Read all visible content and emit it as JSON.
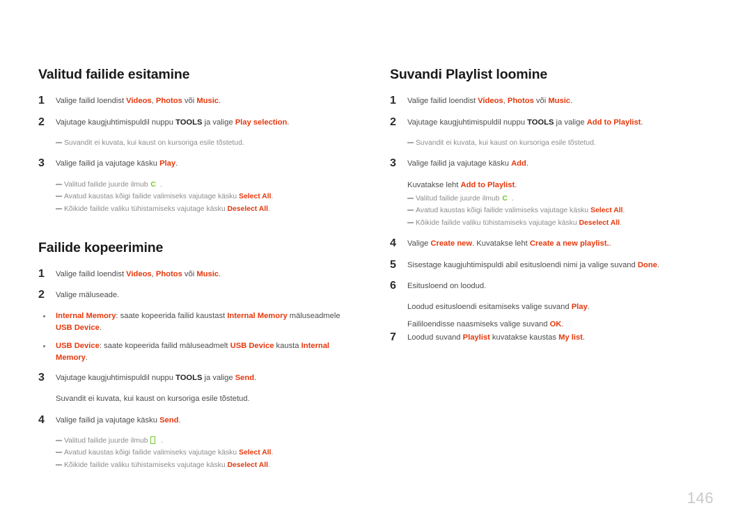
{
  "page": {
    "number": "146",
    "accent_color": "#e5380c",
    "glyph_color": "#6ec72a",
    "body_color": "#4c4c4c",
    "subnote_color": "#8d8d8d"
  },
  "left_column": {
    "sections": [
      {
        "title": "Valitud failide esitamine",
        "blocks": [
          {
            "kind": "step",
            "num": "1",
            "parts": [
              {
                "t": "Valige failid loendist ",
                "s": "plain"
              },
              {
                "t": "Videos",
                "s": "kw"
              },
              {
                "t": ", ",
                "s": "plain"
              },
              {
                "t": "Photos",
                "s": "kw"
              },
              {
                "t": " või ",
                "s": "plain"
              },
              {
                "t": "Music",
                "s": "kw"
              },
              {
                "t": ".",
                "s": "plain"
              }
            ]
          },
          {
            "kind": "step",
            "num": "2",
            "parts": [
              {
                "t": "Vajutage kaugjuhtimispuldil nuppu ",
                "s": "plain"
              },
              {
                "t": "TOOLS",
                "s": "kw-dark"
              },
              {
                "t": " ja valige ",
                "s": "plain"
              },
              {
                "t": "Play selection",
                "s": "kw"
              },
              {
                "t": ".",
                "s": "plain"
              }
            ]
          },
          {
            "kind": "subnotes",
            "items": [
              {
                "parts": [
                  {
                    "t": "Suvandit ei kuvata, kui kaust on kursoriga esile tõstetud.",
                    "s": "plain"
                  }
                ]
              }
            ]
          },
          {
            "kind": "step",
            "num": "3",
            "parts": [
              {
                "t": "Valige failid ja vajutage käsku ",
                "s": "plain"
              },
              {
                "t": "Play",
                "s": "kw"
              },
              {
                "t": ".",
                "s": "plain"
              }
            ]
          },
          {
            "kind": "subnotes",
            "items": [
              {
                "parts": [
                  {
                    "t": "Valitud failide juurde ilmub ",
                    "s": "plain"
                  },
                  {
                    "t": "C",
                    "s": "glyph-check"
                  },
                  {
                    "t": ".",
                    "s": "plain"
                  }
                ]
              },
              {
                "parts": [
                  {
                    "t": "Avatud kaustas kõigi failide valimiseks vajutage käsku ",
                    "s": "plain"
                  },
                  {
                    "t": "Select All",
                    "s": "kw"
                  },
                  {
                    "t": ".",
                    "s": "plain"
                  }
                ]
              },
              {
                "parts": [
                  {
                    "t": "Kõikide failide valiku tühistamiseks vajutage käsku ",
                    "s": "plain"
                  },
                  {
                    "t": "Deselect All",
                    "s": "kw"
                  },
                  {
                    "t": ".",
                    "s": "plain"
                  }
                ]
              }
            ]
          }
        ]
      },
      {
        "title": "Failide kopeerimine",
        "blocks": [
          {
            "kind": "step",
            "num": "1",
            "parts": [
              {
                "t": "Valige failid loendist ",
                "s": "plain"
              },
              {
                "t": "Videos",
                "s": "kw"
              },
              {
                "t": ", ",
                "s": "plain"
              },
              {
                "t": "Photos",
                "s": "kw"
              },
              {
                "t": " või ",
                "s": "plain"
              },
              {
                "t": "Music",
                "s": "kw"
              },
              {
                "t": ".",
                "s": "plain"
              }
            ]
          },
          {
            "kind": "step",
            "num": "2",
            "parts": [
              {
                "t": "Valige mäluseade.",
                "s": "plain"
              }
            ]
          },
          {
            "kind": "bullets",
            "items": [
              {
                "parts": [
                  {
                    "t": "Internal Memory",
                    "s": "kw"
                  },
                  {
                    "t": ": saate kopeerida failid kaustast ",
                    "s": "plain"
                  },
                  {
                    "t": "Internal Memory",
                    "s": "kw"
                  },
                  {
                    "t": " mäluseadmele ",
                    "s": "plain"
                  },
                  {
                    "t": "USB Device",
                    "s": "kw"
                  },
                  {
                    "t": ".",
                    "s": "plain"
                  }
                ]
              },
              {
                "parts": [
                  {
                    "t": "USB Device",
                    "s": "kw"
                  },
                  {
                    "t": ": saate kopeerida failid mäluseadmelt ",
                    "s": "plain"
                  },
                  {
                    "t": "USB Device",
                    "s": "kw"
                  },
                  {
                    "t": " kausta ",
                    "s": "plain"
                  },
                  {
                    "t": "Internal Memory",
                    "s": "kw"
                  },
                  {
                    "t": ".",
                    "s": "plain"
                  }
                ]
              }
            ]
          },
          {
            "kind": "step",
            "num": "3",
            "parts": [
              {
                "t": "Vajutage kaugjuhtimispuldil nuppu ",
                "s": "plain"
              },
              {
                "t": "TOOLS",
                "s": "kw-dark"
              },
              {
                "t": " ja valige ",
                "s": "plain"
              },
              {
                "t": "Send",
                "s": "kw"
              },
              {
                "t": ".",
                "s": "plain"
              }
            ]
          },
          {
            "kind": "body",
            "parts": [
              {
                "t": "Suvandit ei kuvata, kui kaust on kursoriga esile tõstetud.",
                "s": "plain"
              }
            ]
          },
          {
            "kind": "step",
            "num": "4",
            "parts": [
              {
                "t": "Valige failid ja vajutage käsku ",
                "s": "plain"
              },
              {
                "t": "Send",
                "s": "kw"
              },
              {
                "t": ".",
                "s": "plain"
              }
            ]
          },
          {
            "kind": "subnotes",
            "items": [
              {
                "parts": [
                  {
                    "t": "Valitud failide juurde ilmub ",
                    "s": "plain"
                  },
                  {
                    "t": " ",
                    "s": "glyph-box"
                  },
                  {
                    "t": ".",
                    "s": "plain"
                  }
                ]
              },
              {
                "parts": [
                  {
                    "t": "Avatud kaustas kõigi failide valimiseks vajutage käsku ",
                    "s": "plain"
                  },
                  {
                    "t": "Select All",
                    "s": "kw"
                  },
                  {
                    "t": ".",
                    "s": "plain"
                  }
                ]
              },
              {
                "parts": [
                  {
                    "t": "Kõikide failide valiku tühistamiseks vajutage käsku ",
                    "s": "plain"
                  },
                  {
                    "t": "Deselect All",
                    "s": "kw"
                  },
                  {
                    "t": ".",
                    "s": "plain"
                  }
                ]
              }
            ]
          }
        ]
      }
    ]
  },
  "right_column": {
    "sections": [
      {
        "title": "Suvandi Playlist loomine",
        "blocks": [
          {
            "kind": "step",
            "num": "1",
            "parts": [
              {
                "t": "Valige failid loendist ",
                "s": "plain"
              },
              {
                "t": "Videos",
                "s": "kw"
              },
              {
                "t": ", ",
                "s": "plain"
              },
              {
                "t": "Photos",
                "s": "kw"
              },
              {
                "t": " või ",
                "s": "plain"
              },
              {
                "t": "Music",
                "s": "kw"
              },
              {
                "t": ".",
                "s": "plain"
              }
            ]
          },
          {
            "kind": "step",
            "num": "2",
            "parts": [
              {
                "t": "Vajutage kaugjuhtimispuldil nuppu ",
                "s": "plain"
              },
              {
                "t": "TOOLS",
                "s": "kw-dark"
              },
              {
                "t": " ja valige ",
                "s": "plain"
              },
              {
                "t": "Add to Playlist",
                "s": "kw"
              },
              {
                "t": ".",
                "s": "plain"
              }
            ]
          },
          {
            "kind": "subnotes",
            "items": [
              {
                "parts": [
                  {
                    "t": "Suvandit ei kuvata, kui kaust on kursoriga esile tõstetud.",
                    "s": "plain"
                  }
                ]
              }
            ]
          },
          {
            "kind": "step",
            "num": "3",
            "parts": [
              {
                "t": "Valige failid ja vajutage käsku ",
                "s": "plain"
              },
              {
                "t": "Add",
                "s": "kw"
              },
              {
                "t": ".",
                "s": "plain"
              }
            ]
          },
          {
            "kind": "body-compact",
            "parts": [
              {
                "t": "Kuvatakse leht ",
                "s": "plain"
              },
              {
                "t": "Add to Playlist",
                "s": "kw"
              },
              {
                "t": ".",
                "s": "plain"
              }
            ]
          },
          {
            "kind": "subnotes-nogap",
            "items": [
              {
                "parts": [
                  {
                    "t": "Valitud failide juurde ilmub ",
                    "s": "plain"
                  },
                  {
                    "t": "C",
                    "s": "glyph-check"
                  },
                  {
                    "t": ".",
                    "s": "plain"
                  }
                ]
              },
              {
                "parts": [
                  {
                    "t": "Avatud kaustas kõigi failide valimiseks vajutage käsku ",
                    "s": "plain"
                  },
                  {
                    "t": "Select All",
                    "s": "kw"
                  },
                  {
                    "t": ".",
                    "s": "plain"
                  }
                ]
              },
              {
                "parts": [
                  {
                    "t": "Kõikide failide valiku tühistamiseks vajutage käsku ",
                    "s": "plain"
                  },
                  {
                    "t": "Deselect All",
                    "s": "kw"
                  },
                  {
                    "t": ".",
                    "s": "plain"
                  }
                ]
              }
            ]
          },
          {
            "kind": "step",
            "num": "4",
            "parts": [
              {
                "t": "Valige ",
                "s": "plain"
              },
              {
                "t": "Create new",
                "s": "kw"
              },
              {
                "t": ". Kuvatakse leht ",
                "s": "plain"
              },
              {
                "t": "Create a new playlist.",
                "s": "kw"
              },
              {
                "t": ".",
                "s": "plain"
              }
            ]
          },
          {
            "kind": "step",
            "num": "5",
            "parts": [
              {
                "t": "Sisestage kaugjuhtimispuldi abil esitusloendi nimi ja valige suvand ",
                "s": "plain"
              },
              {
                "t": "Done",
                "s": "kw"
              },
              {
                "t": ".",
                "s": "plain"
              }
            ]
          },
          {
            "kind": "step",
            "num": "6",
            "parts": [
              {
                "t": "Esitusloend on loodud.",
                "s": "plain"
              }
            ]
          },
          {
            "kind": "body-tight",
            "parts": [
              {
                "t": "Loodud esitusloendi esitamiseks valige suvand ",
                "s": "plain"
              },
              {
                "t": "Play",
                "s": "kw"
              },
              {
                "t": ".",
                "s": "plain"
              }
            ]
          },
          {
            "kind": "body-compact",
            "parts": [
              {
                "t": "Faililoendisse naasmiseks valige suvand ",
                "s": "plain"
              },
              {
                "t": "OK",
                "s": "kw"
              },
              {
                "t": ".",
                "s": "plain"
              }
            ]
          },
          {
            "kind": "step",
            "num": "7",
            "parts": [
              {
                "t": "Loodud suvand ",
                "s": "plain"
              },
              {
                "t": "Playlist",
                "s": "kw"
              },
              {
                "t": " kuvatakse kaustas ",
                "s": "plain"
              },
              {
                "t": "My list",
                "s": "kw"
              },
              {
                "t": ".",
                "s": "plain"
              }
            ]
          }
        ]
      }
    ]
  }
}
